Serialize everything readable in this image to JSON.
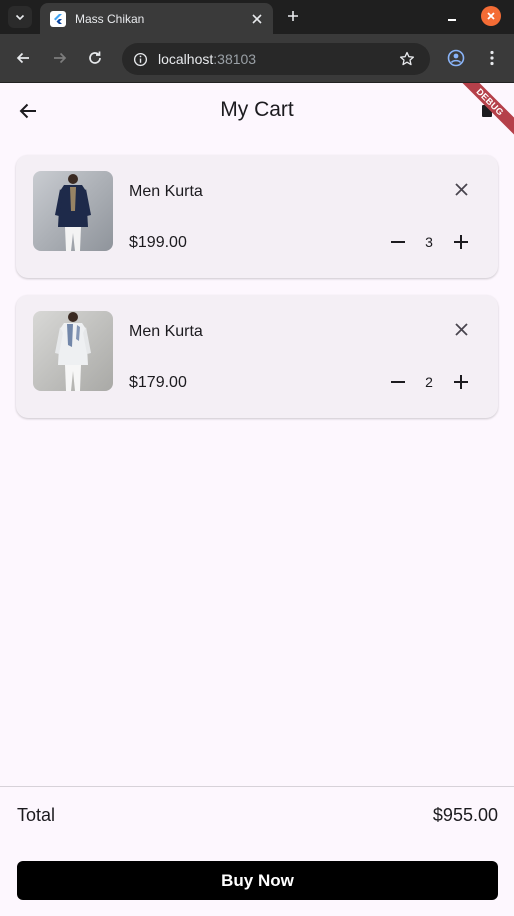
{
  "browser": {
    "tab_title": "Mass Chikan",
    "url_host": "localhost",
    "url_port": ":38103"
  },
  "app": {
    "title": "My Cart",
    "debug_label": "DEBUG"
  },
  "cart": {
    "items": [
      {
        "name": "Men Kurta",
        "price": "$199.00",
        "quantity": "3",
        "image": "navy-kurta-photo"
      },
      {
        "name": "Men Kurta",
        "price": "$179.00",
        "quantity": "2",
        "image": "white-kurta-photo"
      }
    ]
  },
  "footer": {
    "total_label": "Total",
    "total_value": "$955.00",
    "buy_label": "Buy Now"
  },
  "colors": {
    "background": "#fdf7fe",
    "card": "#f4eff5",
    "button": "#000000",
    "debug_banner": "#b5404a"
  }
}
